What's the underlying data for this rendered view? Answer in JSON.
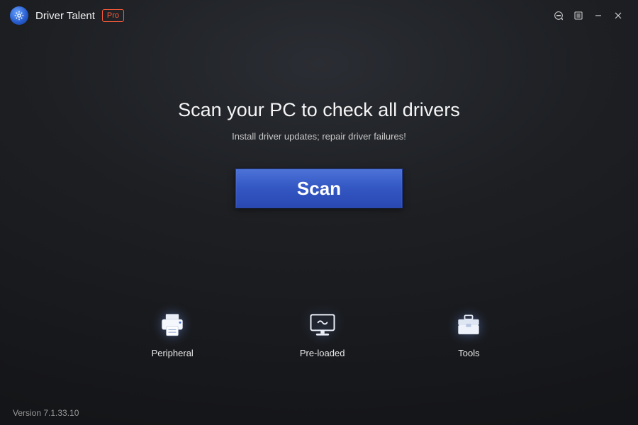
{
  "app": {
    "title": "Driver Talent",
    "badge": "Pro"
  },
  "main": {
    "headline": "Scan your PC to check all drivers",
    "subhead": "Install driver updates; repair driver failures!",
    "scan_label": "Scan"
  },
  "features": {
    "peripheral": "Peripheral",
    "preloaded": "Pre-loaded",
    "tools": "Tools"
  },
  "status": {
    "version": "Version 7.1.33.10"
  },
  "colors": {
    "accent": "#3356c2",
    "pro_badge": "#ff5b3a"
  }
}
